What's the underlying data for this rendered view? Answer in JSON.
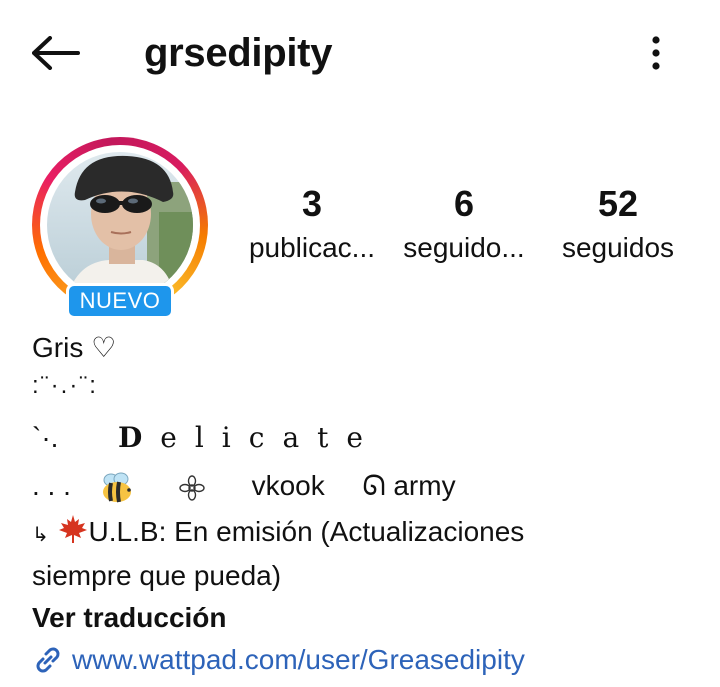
{
  "header": {
    "username": "grsedipity",
    "back_icon": "arrow-left-icon",
    "more_icon": "kebab-menu-icon"
  },
  "profile": {
    "badge": "NUEVO",
    "ring_colors": [
      "#f9a825",
      "#e91e63",
      "#c2185b"
    ],
    "badge_color": "#1e96ec"
  },
  "stats": [
    {
      "value": "3",
      "label": "publicac..."
    },
    {
      "value": "6",
      "label": "seguido..."
    },
    {
      "value": "52",
      "label": "seguidos"
    }
  ],
  "bio": {
    "name": "Gris ♡",
    "line1": ":¨·.·¨:",
    "line2_prefix": "`·.",
    "line2_word": "Delicate",
    "line3_dots": ". . .",
    "line3_tag1": "vkook",
    "line3_tag2_symbol": "ᘏ",
    "line3_tag2": "army",
    "line4_arrow": "↳",
    "line4_text": "U.L.B:  En emisión (Actualizaciones",
    "line5_text": "siempre que pueda)",
    "translate_label": "Ver traducción",
    "link": "www.wattpad.com/user/Greasedipity",
    "link_color": "#2d63b9"
  }
}
